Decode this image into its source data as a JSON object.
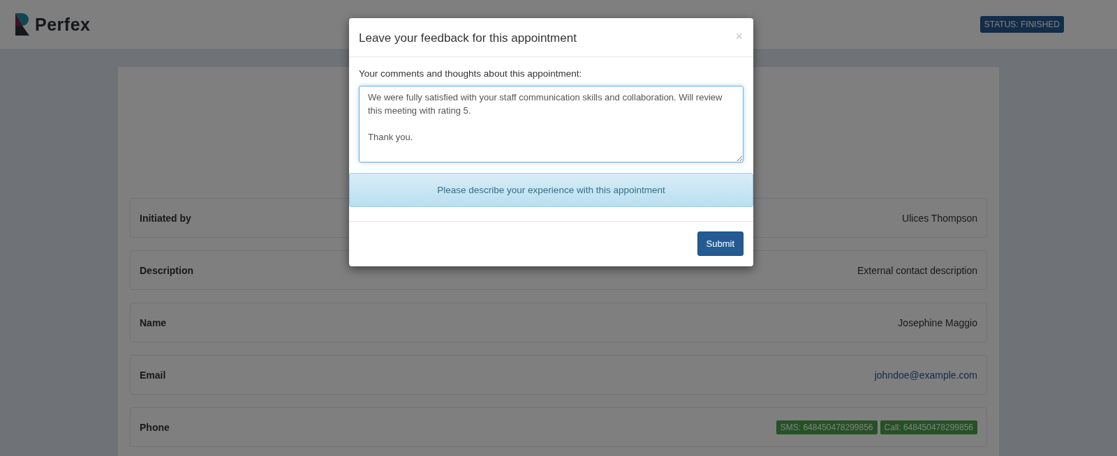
{
  "header": {
    "logo_text": "Perfex",
    "status_badge": "STATUS: FINISHED"
  },
  "details": [
    {
      "kind": "text",
      "label": "Initiated by",
      "value": "Ulices Thompson"
    },
    {
      "kind": "text",
      "label": "Description",
      "value": "External contact description"
    },
    {
      "kind": "text",
      "label": "Name",
      "value": "Josephine Maggio"
    },
    {
      "kind": "link",
      "label": "Email",
      "value": "johndoe@example.com"
    },
    {
      "kind": "badges",
      "label": "Phone",
      "badges": [
        "SMS: 648450478299856",
        "Call: 648450478299856"
      ]
    }
  ],
  "modal": {
    "title": "Leave your feedback for this appointment",
    "close": "×",
    "field_label": "Your comments and thoughts about this appointment:",
    "comments": "We were fully satisfied with your staff communication skills and collaboration. Will review this meeting with rating 5.\n\nThank you.",
    "alert": "Please describe your experience with this appointment",
    "submit": "Submit"
  }
}
